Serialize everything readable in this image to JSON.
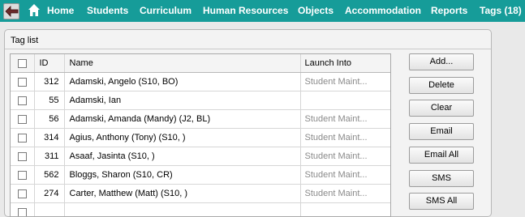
{
  "nav": {
    "items": [
      "Home",
      "Students",
      "Curriculum",
      "Human Resources",
      "Objects",
      "Accommodation",
      "Reports",
      "Tags (18)"
    ]
  },
  "panel": {
    "title": "Tag list"
  },
  "table": {
    "headers": {
      "id": "ID",
      "name": "Name",
      "launch": "Launch Into"
    },
    "rows": [
      {
        "id": "312",
        "name": "Adamski, Angelo (S10, BO)",
        "launch": "Student Maint..."
      },
      {
        "id": "55",
        "name": "Adamski, Ian",
        "launch": ""
      },
      {
        "id": "56",
        "name": "Adamski, Amanda (Mandy) (J2, BL)",
        "launch": "Student Maint..."
      },
      {
        "id": "314",
        "name": "Agius, Anthony (Tony) (S10, )",
        "launch": "Student Maint..."
      },
      {
        "id": "311",
        "name": "Asaaf, Jasinta (S10, )",
        "launch": "Student Maint..."
      },
      {
        "id": "562",
        "name": "Bloggs, Sharon (S10, CR)",
        "launch": "Student Maint..."
      },
      {
        "id": "274",
        "name": "Carter, Matthew (Matt) (S10, )",
        "launch": "Student Maint..."
      },
      {
        "id": "",
        "name": "",
        "launch": ""
      }
    ]
  },
  "actions": {
    "buttons": [
      "Add...",
      "Delete",
      "Clear",
      "Email",
      "Email All",
      "SMS",
      "SMS All"
    ]
  },
  "icons": {
    "back": "back-arrow-icon",
    "home": "home-icon"
  },
  "colors": {
    "nav_bg": "#169c99",
    "nav_text": "#ffffff"
  }
}
